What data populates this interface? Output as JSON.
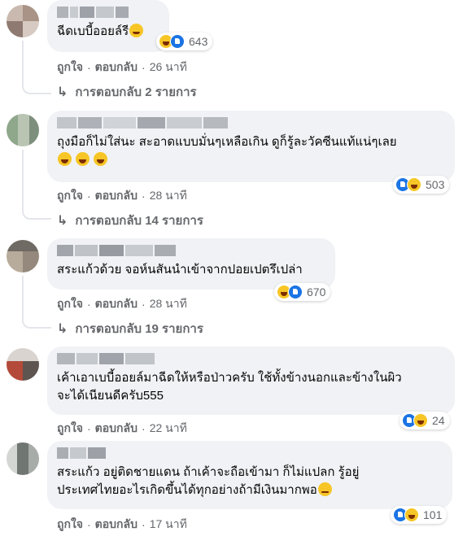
{
  "actions": {
    "like": "ถูกใจ",
    "reply": "ตอบกลับ",
    "separator": "·"
  },
  "comments": [
    {
      "text_lines": [
        "ฉีดเบบี้ออยล์รี"
      ],
      "reaction_count": "643",
      "time": "26 นาที",
      "replies_label": "การตอบกลับ 2 รายการ"
    },
    {
      "text_lines": [
        "ถุงมือก็ไม่ใส่นะ สะอาดแบบมั่นๆเหลือเกิน ดูก็รู้ละวัคซีนแท้แน่ๆเลย"
      ],
      "reaction_count": "503",
      "time": "28 นาที",
      "replies_label": "การตอบกลับ 14 รายการ"
    },
    {
      "text_lines": [
        "สระแก้วด้วย จอห์นสันนำเข้าจากปอยเปตรึเปล่า"
      ],
      "reaction_count": "670",
      "time": "28 นาที",
      "replies_label": "การตอบกลับ 19 รายการ"
    },
    {
      "text_lines": [
        "เค้าเอาเบบี้ออยล์มาฉีดให้หรือป่าวครับ ใช้ทั้งข้างนอกและข้างในผิว",
        "จะได้เนียนดีครับ555"
      ],
      "reaction_count": "24",
      "time": "22 นาที"
    },
    {
      "text_lines": [
        "สระแก้ว อยู่ติดชายแดน ถ้าเค้าจะถือเข้ามา ก็ไม่แปลก รู้อยู่",
        "ประเทศไทยอะไรเกิดขึ้นได้ทุกอย่างถ้ามีเงินมากพอ"
      ],
      "reaction_count": "101",
      "time": "17 นาที"
    }
  ],
  "colors": {
    "bubble": "#f0f2f5",
    "meta_text": "#65676b",
    "like_blue": "#1b74e4",
    "haha_yellow": "#f7c626"
  }
}
